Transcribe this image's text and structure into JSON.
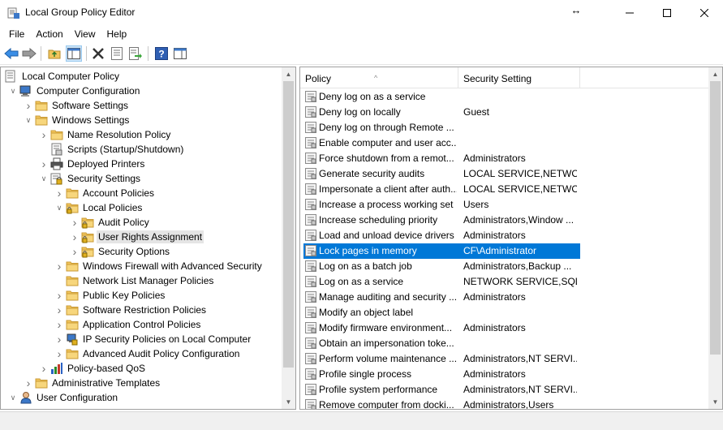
{
  "window": {
    "title": "Local Group Policy Editor",
    "minimize": "—",
    "maximize": "☐",
    "close": "✕",
    "resize_glyph": "↔"
  },
  "menu": [
    "File",
    "Action",
    "View",
    "Help"
  ],
  "toolbar": {
    "buttons": [
      "back-icon",
      "forward-icon",
      "up-folder-icon",
      "show-hide-tree-icon",
      "delete-icon",
      "properties-icon",
      "export-list-icon",
      "help-icon",
      "show-hide-action-pane-icon"
    ]
  },
  "tree": [
    {
      "label": "Local Computer Policy",
      "level": 0,
      "icon": "computer-policy",
      "exp": ""
    },
    {
      "label": "Computer Configuration",
      "level": 1,
      "icon": "computer",
      "exp": "open"
    },
    {
      "label": "Software Settings",
      "level": 2,
      "icon": "folder",
      "exp": "closed"
    },
    {
      "label": "Windows Settings",
      "level": 2,
      "icon": "folder",
      "exp": "open"
    },
    {
      "label": "Name Resolution Policy",
      "level": 3,
      "icon": "folder",
      "exp": "closed"
    },
    {
      "label": "Scripts (Startup/Shutdown)",
      "level": 3,
      "icon": "script",
      "exp": ""
    },
    {
      "label": "Deployed Printers",
      "level": 3,
      "icon": "printer",
      "exp": "closed"
    },
    {
      "label": "Security Settings",
      "level": 3,
      "icon": "security",
      "exp": "open"
    },
    {
      "label": "Account Policies",
      "level": 4,
      "icon": "folder",
      "exp": "closed"
    },
    {
      "label": "Local Policies",
      "level": 4,
      "icon": "folder-lock",
      "exp": "open"
    },
    {
      "label": "Audit Policy",
      "level": 5,
      "icon": "folder-lock",
      "exp": "closed"
    },
    {
      "label": "User Rights Assignment",
      "level": 5,
      "icon": "folder-lock",
      "exp": "closed",
      "selected": true
    },
    {
      "label": "Security Options",
      "level": 5,
      "icon": "folder-lock",
      "exp": "closed"
    },
    {
      "label": "Windows Firewall with Advanced Security",
      "level": 4,
      "icon": "folder",
      "exp": "closed"
    },
    {
      "label": "Network List Manager Policies",
      "level": 4,
      "icon": "folder",
      "exp": ""
    },
    {
      "label": "Public Key Policies",
      "level": 4,
      "icon": "folder",
      "exp": "closed"
    },
    {
      "label": "Software Restriction Policies",
      "level": 4,
      "icon": "folder",
      "exp": "closed"
    },
    {
      "label": "Application Control Policies",
      "level": 4,
      "icon": "folder",
      "exp": "closed"
    },
    {
      "label": "IP Security Policies on Local Computer",
      "level": 4,
      "icon": "ipsec",
      "exp": "closed"
    },
    {
      "label": "Advanced Audit Policy Configuration",
      "level": 4,
      "icon": "folder",
      "exp": "closed"
    },
    {
      "label": "Policy-based QoS",
      "level": 3,
      "icon": "qos",
      "exp": "closed"
    },
    {
      "label": "Administrative Templates",
      "level": 2,
      "icon": "folder",
      "exp": "closed"
    },
    {
      "label": "User Configuration",
      "level": 1,
      "icon": "user",
      "exp": "open"
    }
  ],
  "list": {
    "columns": {
      "policy": "Policy",
      "setting": "Security Setting"
    },
    "rows": [
      {
        "policy": "Deny log on as a service",
        "setting": ""
      },
      {
        "policy": "Deny log on locally",
        "setting": "Guest"
      },
      {
        "policy": "Deny log on through Remote ...",
        "setting": ""
      },
      {
        "policy": "Enable computer and user acc...",
        "setting": ""
      },
      {
        "policy": "Force shutdown from a remot...",
        "setting": "Administrators"
      },
      {
        "policy": "Generate security audits",
        "setting": "LOCAL SERVICE,NETWO..."
      },
      {
        "policy": "Impersonate a client after auth...",
        "setting": "LOCAL SERVICE,NETWO..."
      },
      {
        "policy": "Increase a process working set",
        "setting": "Users"
      },
      {
        "policy": "Increase scheduling priority",
        "setting": "Administrators,Window ..."
      },
      {
        "policy": "Load and unload device drivers",
        "setting": "Administrators"
      },
      {
        "policy": "Lock pages in memory",
        "setting": "CF\\Administrator",
        "selected": true
      },
      {
        "policy": "Log on as a batch job",
        "setting": "Administrators,Backup ..."
      },
      {
        "policy": "Log on as a service",
        "setting": "NETWORK SERVICE,SQL..."
      },
      {
        "policy": "Manage auditing and security ...",
        "setting": "Administrators"
      },
      {
        "policy": "Modify an object label",
        "setting": ""
      },
      {
        "policy": "Modify firmware environment...",
        "setting": "Administrators"
      },
      {
        "policy": "Obtain an impersonation toke...",
        "setting": ""
      },
      {
        "policy": "Perform volume maintenance ...",
        "setting": "Administrators,NT SERVI..."
      },
      {
        "policy": "Profile single process",
        "setting": "Administrators"
      },
      {
        "policy": "Profile system performance",
        "setting": "Administrators,NT SERVI..."
      },
      {
        "policy": "Remove computer from docki...",
        "setting": "Administrators,Users"
      }
    ]
  },
  "colors": {
    "selection": "#0078d7",
    "tree_selection": "#e5e5e5",
    "folder": "#f2c55c",
    "folder_dark": "#d9a93a"
  }
}
